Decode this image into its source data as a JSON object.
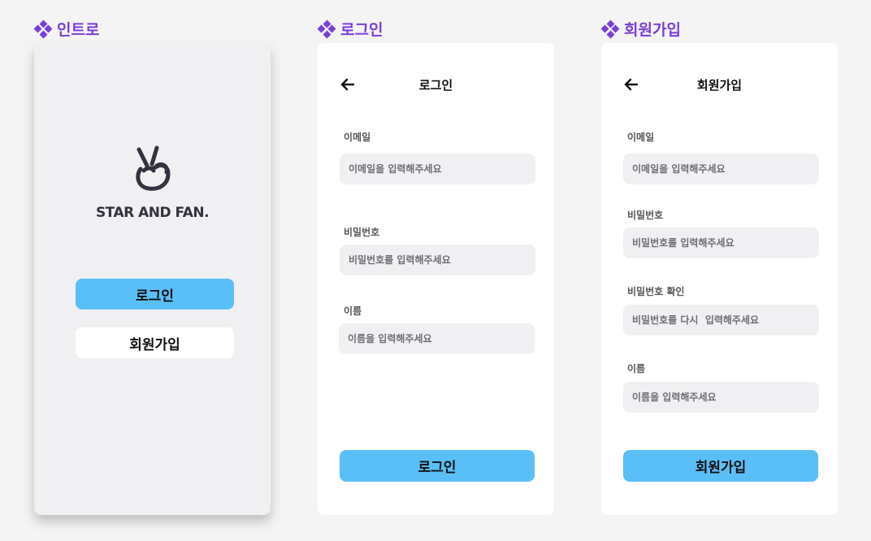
{
  "sections": {
    "intro": "인트로",
    "login": "로그인",
    "signup": "회원가입"
  },
  "intro": {
    "logo_text": "STAR AND FAN.",
    "login_button": "로그인",
    "signup_button": "회원가입"
  },
  "login": {
    "title": "로그인",
    "email_label": "이메일",
    "email_placeholder": "이메일을 입력해주세요",
    "password_label": "비밀번호",
    "password_placeholder": "비밀번호를 입력해주세요",
    "name_label": "이름",
    "name_placeholder": "이름을 입력해주세요",
    "submit": "로그인"
  },
  "signup": {
    "title": "회원가입",
    "email_label": "이메일",
    "email_placeholder": "이메일을 입력해주세요",
    "password_label": "비밀번호",
    "password_placeholder": "비밀번호를 입력해주세요",
    "password_confirm_label": "비밀번호 확인",
    "password_confirm_placeholder": "비밀번호를 다시  입력해주세요",
    "name_label": "이름",
    "name_placeholder": "이름을 입력해주세요",
    "submit": "회원가입"
  },
  "icons": {
    "section": "diamond-cluster-icon",
    "back": "back-arrow-icon",
    "logo": "v-hand-logo-icon"
  },
  "colors": {
    "accent": "#7a3fd8",
    "primary_button": "#5bbff7",
    "input_bg": "#f0f0f2"
  }
}
